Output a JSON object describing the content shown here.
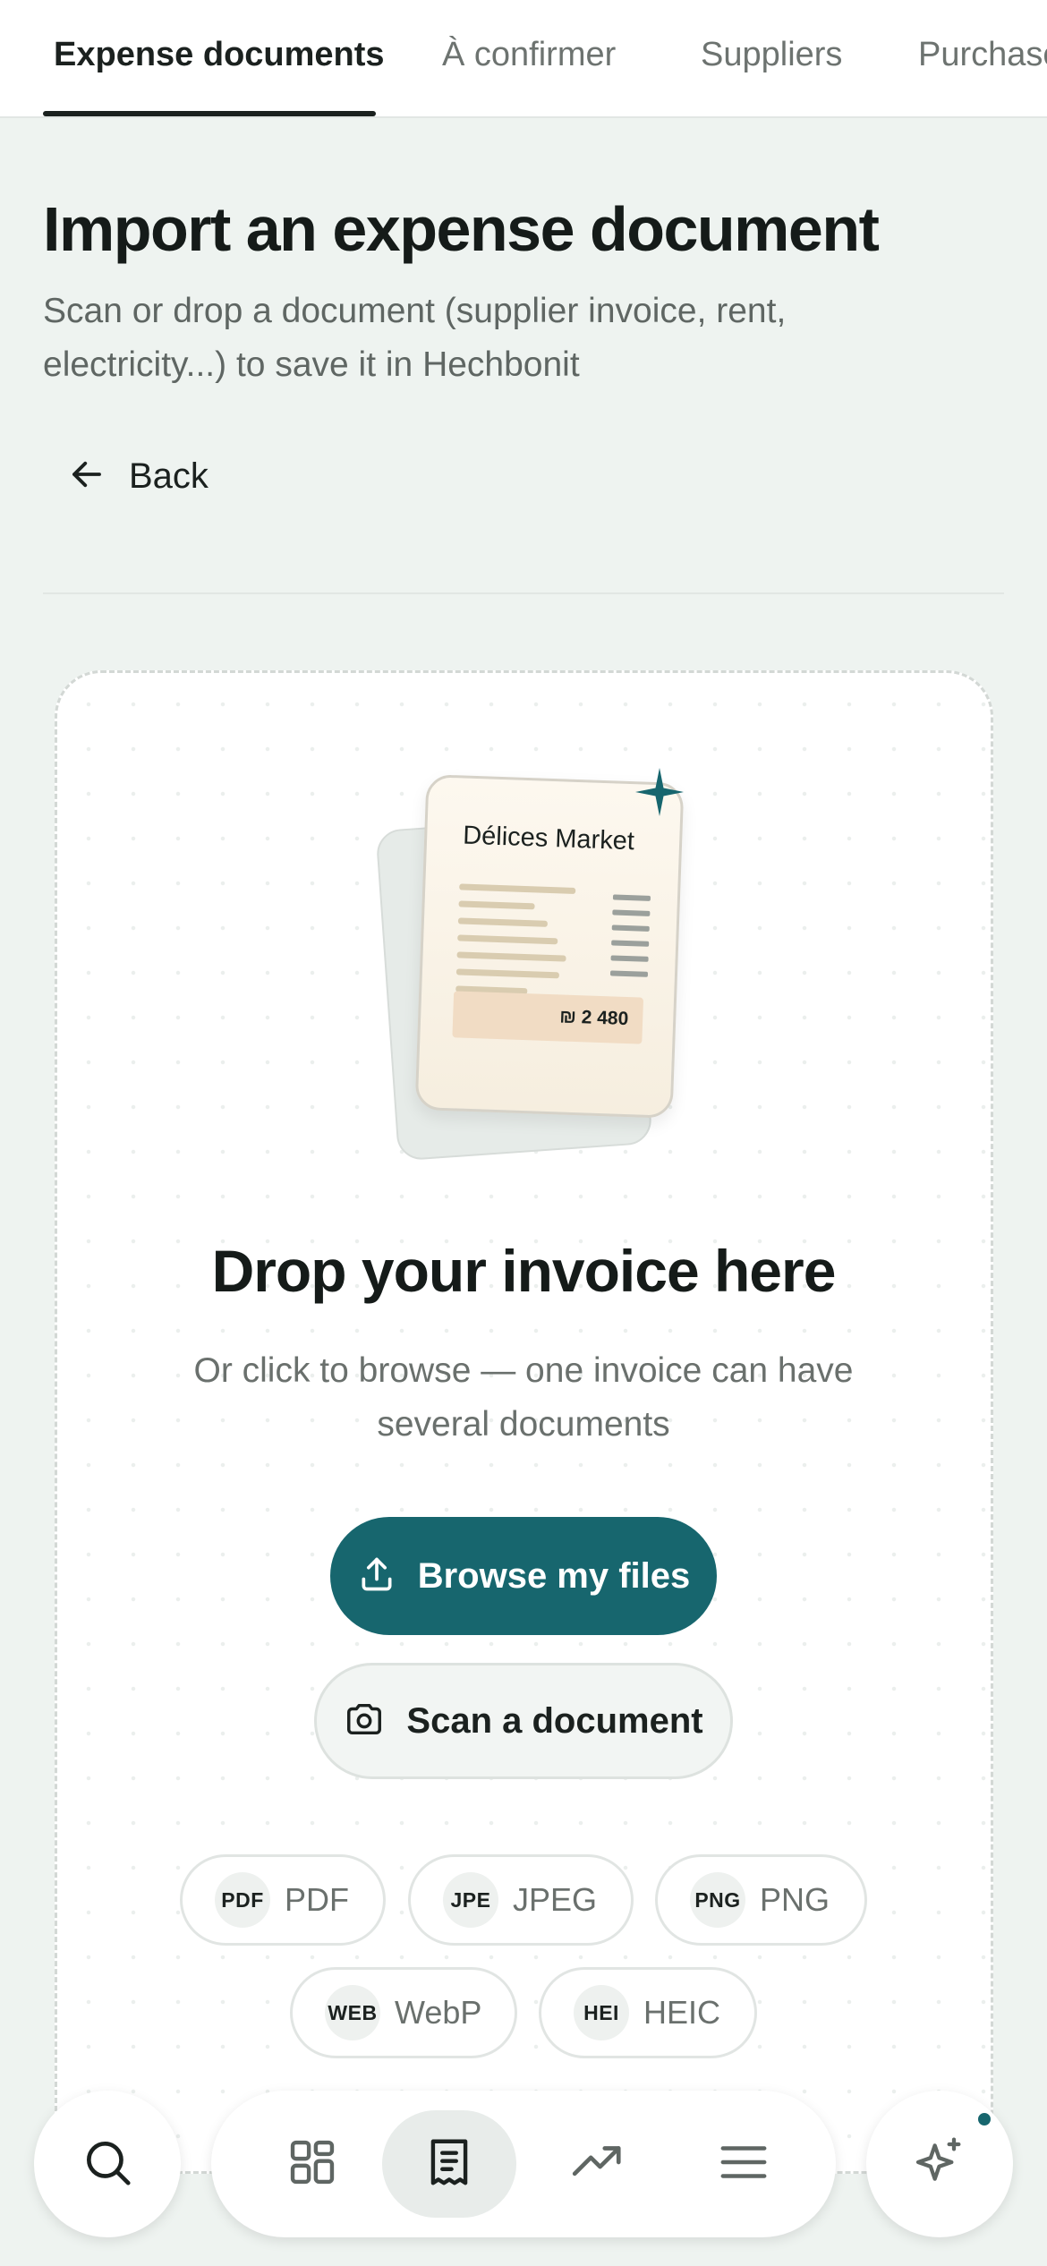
{
  "tabs": [
    {
      "label": "Expense documents",
      "active": true
    },
    {
      "label": "À confirmer",
      "active": false
    },
    {
      "label": "Suppliers",
      "active": false
    },
    {
      "label": "Purchase",
      "active": false
    }
  ],
  "header": {
    "title": "Import an expense document",
    "subtitle": "Scan or drop a document (supplier invoice, rent, electricity...) to save it in Hechbonit",
    "back_label": "Back"
  },
  "illustration": {
    "vendor": "Délices Market",
    "amount": "₪ 2 480"
  },
  "dropzone": {
    "title": "Drop your invoice here",
    "subtitle": "Or click to browse — one invoice can have several documents",
    "browse_label": "Browse my files",
    "scan_label": "Scan a document",
    "formats": [
      {
        "badge": "PDF",
        "label": "PDF"
      },
      {
        "badge": "JPE",
        "label": "JPEG"
      },
      {
        "badge": "PNG",
        "label": "PNG"
      },
      {
        "badge": "WEB",
        "label": "WebP"
      },
      {
        "badge": "HEI",
        "label": "HEIC"
      }
    ]
  },
  "bottom_nav": {
    "items": [
      {
        "icon": "search-icon"
      },
      {
        "icon": "dashboard-grid-icon"
      },
      {
        "icon": "receipt-icon",
        "active": true
      },
      {
        "icon": "trending-up-icon"
      },
      {
        "icon": "menu-icon"
      },
      {
        "icon": "sparkle-ai-icon",
        "notification": true
      }
    ]
  },
  "colors": {
    "accent": "#17666e",
    "background": "#eef3f0",
    "text": "#1b211f"
  }
}
